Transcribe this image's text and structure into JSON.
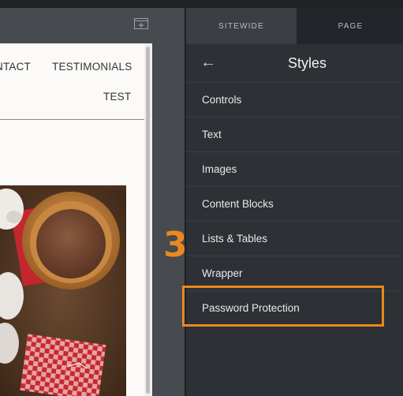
{
  "nav": {
    "contact": "NTACT",
    "testimonials": "TESTIMONIALS",
    "test": "TEST"
  },
  "panel": {
    "tabs": [
      {
        "label": "SITEWIDE",
        "active": true
      },
      {
        "label": "PAGE",
        "active": false
      }
    ],
    "back_icon": "back-arrow-icon",
    "title": "Styles",
    "items": [
      {
        "label": "Controls"
      },
      {
        "label": "Text"
      },
      {
        "label": "Images"
      },
      {
        "label": "Content Blocks"
      },
      {
        "label": "Lists & Tables"
      },
      {
        "label": "Wrapper"
      },
      {
        "label": "Password Protection"
      }
    ]
  },
  "annotation": {
    "step": "3",
    "highlight_color": "#e8891f"
  },
  "icons": {
    "frame": "add-frame-icon"
  }
}
